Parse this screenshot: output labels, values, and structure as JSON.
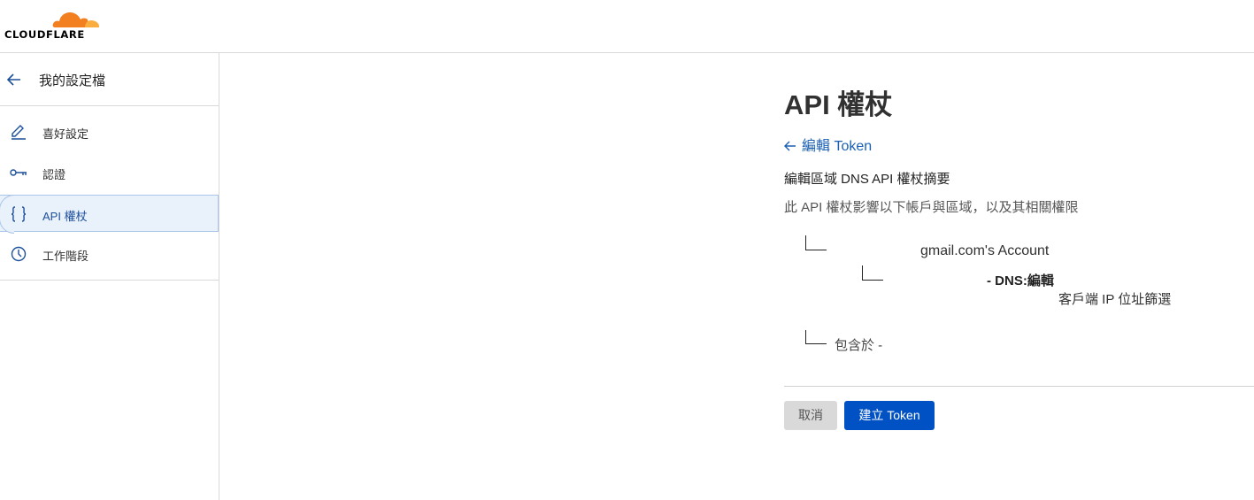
{
  "header": {
    "logo_text": "CLOUDFLARE",
    "logo_colors": {
      "cloud_dark": "#f38020",
      "cloud_light": "#faae40"
    }
  },
  "sidebar": {
    "back_title": "我的設定檔",
    "items": [
      {
        "label": "喜好設定",
        "icon": "pencil-icon",
        "active": false
      },
      {
        "label": "認證",
        "icon": "key-icon",
        "active": false
      },
      {
        "label": "API 權杖",
        "icon": "braces-icon",
        "active": true
      },
      {
        "label": "工作階段",
        "icon": "clock-icon",
        "active": false
      }
    ]
  },
  "main": {
    "title": "API 權杖",
    "back_link": "編輯 Token",
    "summary_title": "編輯區域 DNS API 權杖摘要",
    "summary_desc": "此 API 權杖影響以下帳戶與區域，以及其相關權限",
    "account": "gmail.com's Account",
    "permission": "- DNS:編輯",
    "filter": "客戶端 IP 位址篩選",
    "include": "包含於 -",
    "cancel_label": "取消",
    "create_label": "建立 Token"
  },
  "colors": {
    "accent": "#0051c3",
    "link": "#1a5fb4",
    "active_bg": "#e9f1fb"
  }
}
